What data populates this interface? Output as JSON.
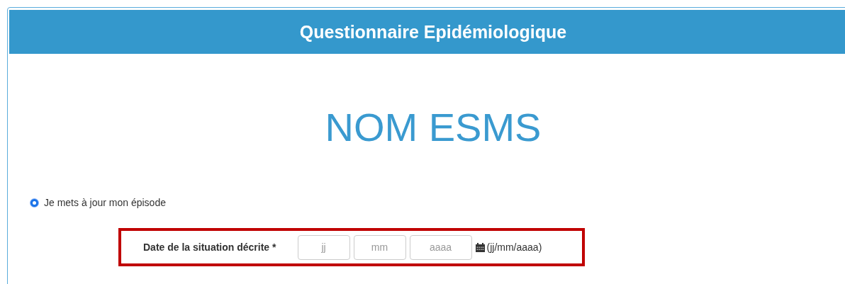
{
  "header": {
    "title": "Questionnaire Epidémiologique"
  },
  "establishment": "NOM ESMS",
  "option": {
    "label": "Je mets à jour mon épisode",
    "checked": true
  },
  "date_field": {
    "label": "Date de la situation décrite *",
    "inputs": [
      {
        "placeholder": "jj"
      },
      {
        "placeholder": "mm"
      },
      {
        "placeholder": "aaaa"
      }
    ],
    "hint": "(jj/mm/aaaa)"
  }
}
